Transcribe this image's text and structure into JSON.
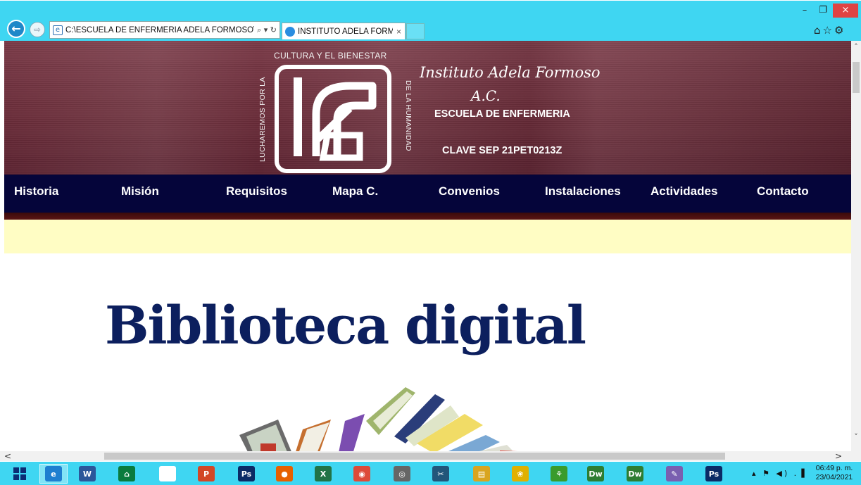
{
  "browser": {
    "url": "C:\\ESCUELA DE ENFERMERIA ADELA FORMOSO\\BIBLI",
    "address_tools": "⌕ ▾ ↻",
    "tab_title": "INSTITUTO ADELA FORMO...",
    "tab_close": "×",
    "back_glyph": "←",
    "forward_glyph": "⇨",
    "win_min": "–",
    "win_restore": "❐",
    "win_close": "×",
    "right_icons": "⌂☆⚙"
  },
  "header": {
    "motto_top": "CULTURA Y EL BIENESTAR",
    "motto_left": "LUCHAREMOS POR LA",
    "motto_right": "DE LA HUMANIDAD",
    "institute_name": "Instituto Adela Formoso",
    "institute_suffix": "A.C.",
    "school": "ESCUELA DE ENFERMERIA",
    "clave": "CLAVE SEP 21PET0213Z"
  },
  "menu": {
    "items": [
      {
        "label": "Historia"
      },
      {
        "label": "Misión"
      },
      {
        "label": "Requisitos"
      },
      {
        "label": "Mapa C."
      },
      {
        "label": "Convenios"
      },
      {
        "label": "Instalaciones"
      },
      {
        "label": "Actividades"
      },
      {
        "label": "Contacto"
      }
    ]
  },
  "main": {
    "hero_title": "Biblioteca digital"
  },
  "scroll": {
    "up": "˄",
    "down": "˅",
    "left": "<",
    "right": ">"
  },
  "taskbar": {
    "apps": [
      {
        "name": "internet-explorer",
        "label": "e",
        "color": "#1e7fd0"
      },
      {
        "name": "word",
        "label": "W",
        "color": "#2b579a"
      },
      {
        "name": "store",
        "label": "⌂",
        "color": "#0a7b3d"
      },
      {
        "name": "file",
        "label": "",
        "color": "#ffffff"
      },
      {
        "name": "powerpoint",
        "label": "P",
        "color": "#d24726"
      },
      {
        "name": "photoshop",
        "label": "Ps",
        "color": "#0b2b66"
      },
      {
        "name": "firefox",
        "label": "●",
        "color": "#e66000"
      },
      {
        "name": "excel",
        "label": "X",
        "color": "#217346"
      },
      {
        "name": "chrome",
        "label": "◉",
        "color": "#dd4b39"
      },
      {
        "name": "dvd",
        "label": "◎",
        "color": "#666666"
      },
      {
        "name": "snipping",
        "label": "✂",
        "color": "#22567a"
      },
      {
        "name": "explorer",
        "label": "▤",
        "color": "#d9a520"
      },
      {
        "name": "paw-app",
        "label": "❀",
        "color": "#e0b000"
      },
      {
        "name": "plant-app",
        "label": "⚘",
        "color": "#3a9b2b"
      },
      {
        "name": "dreamweaver-1",
        "label": "Dw",
        "color": "#2e7d32"
      },
      {
        "name": "dreamweaver-2",
        "label": "Dw",
        "color": "#2e7d32"
      },
      {
        "name": "paint",
        "label": "✎",
        "color": "#7a5fb0"
      },
      {
        "name": "photoshop-2",
        "label": "Ps",
        "color": "#0b2b66"
      }
    ],
    "systray": "▴ ⚑ ◀) .▐",
    "time": "06:49 p. m.",
    "date": "23/04/2021"
  }
}
